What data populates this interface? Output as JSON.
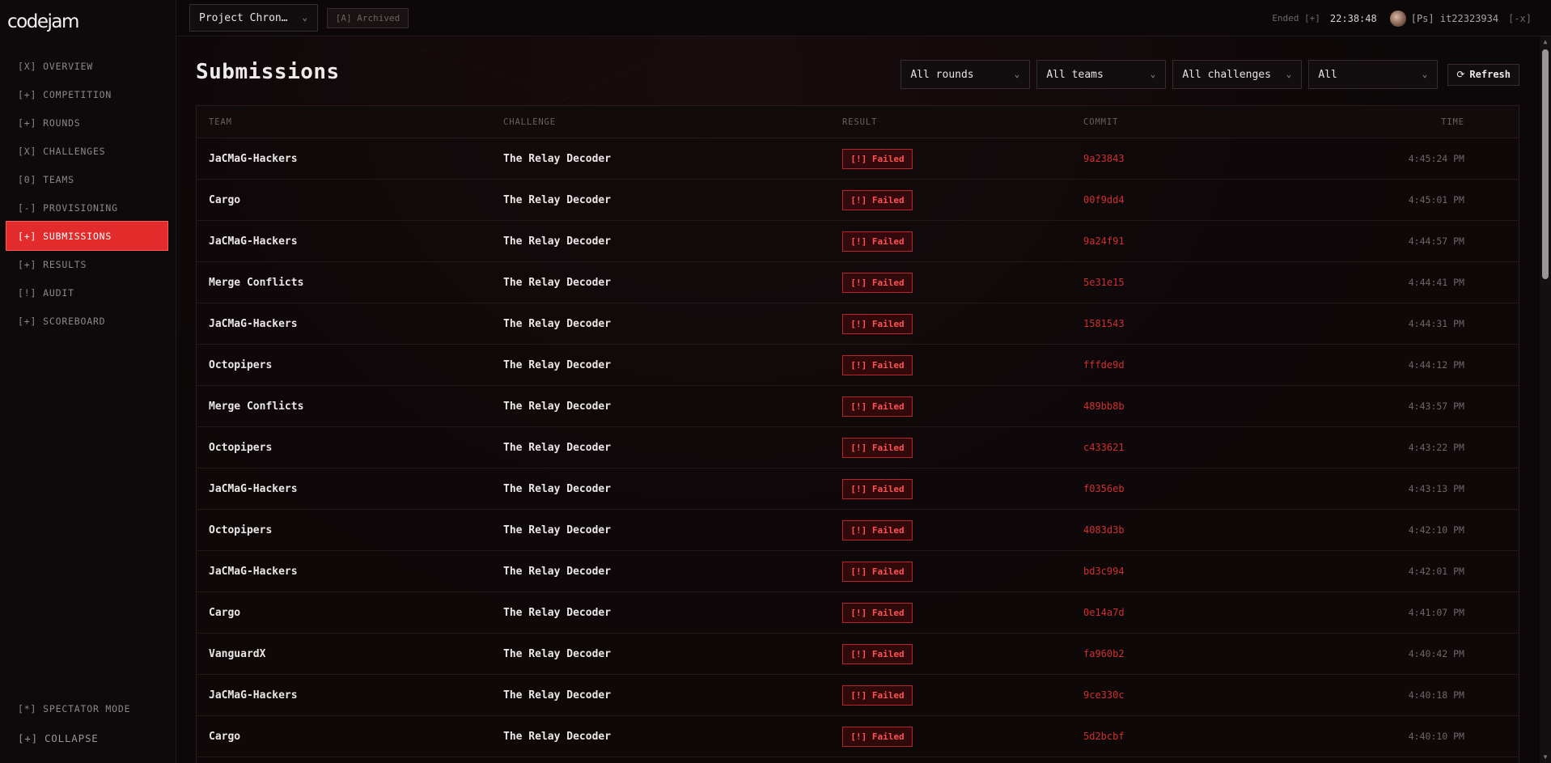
{
  "app": {
    "logo": "codejam"
  },
  "sidebar": {
    "items": [
      {
        "prefix": "[X]",
        "label": "OVERVIEW"
      },
      {
        "prefix": "[+]",
        "label": "COMPETITION"
      },
      {
        "prefix": "[+]",
        "label": "ROUNDS"
      },
      {
        "prefix": "[X]",
        "label": "CHALLENGES"
      },
      {
        "prefix": "[0]",
        "label": "TEAMS"
      },
      {
        "prefix": "[-]",
        "label": "PROVISIONING"
      },
      {
        "prefix": "[+]",
        "label": "SUBMISSIONS",
        "active": true
      },
      {
        "prefix": "[+]",
        "label": "RESULTS"
      },
      {
        "prefix": "[!]",
        "label": "AUDIT"
      },
      {
        "prefix": "[+]",
        "label": "SCOREBOARD"
      }
    ],
    "bottom": [
      {
        "prefix": "[*]",
        "label": "SPECTATOR MODE"
      },
      {
        "prefix": "[+]",
        "label": "COLLAPSE"
      }
    ]
  },
  "topbar": {
    "project": "Project Chron…",
    "archived": "[A] Archived",
    "status": "Ended [+]",
    "clock": "22:38:48",
    "user": "[Ps] it22323934",
    "logout": "[-x]"
  },
  "page": {
    "title": "Submissions",
    "filters": {
      "rounds": "All rounds",
      "teams": "All teams",
      "challenges": "All challenges",
      "status": "All"
    },
    "refresh": "Refresh"
  },
  "table": {
    "headers": {
      "team": "TEAM",
      "challenge": "CHALLENGE",
      "result": "RESULT",
      "commit": "COMMIT",
      "time": "TIME"
    },
    "rows": [
      {
        "team": "JaCMaG-Hackers",
        "challenge": "The Relay Decoder",
        "result": "[!] Failed",
        "commit": "9a23843",
        "time": "4:45:24 PM"
      },
      {
        "team": "Cargo",
        "challenge": "The Relay Decoder",
        "result": "[!] Failed",
        "commit": "00f9dd4",
        "time": "4:45:01 PM"
      },
      {
        "team": "JaCMaG-Hackers",
        "challenge": "The Relay Decoder",
        "result": "[!] Failed",
        "commit": "9a24f91",
        "time": "4:44:57 PM"
      },
      {
        "team": "Merge Conflicts",
        "challenge": "The Relay Decoder",
        "result": "[!] Failed",
        "commit": "5e31e15",
        "time": "4:44:41 PM"
      },
      {
        "team": "JaCMaG-Hackers",
        "challenge": "The Relay Decoder",
        "result": "[!] Failed",
        "commit": "1581543",
        "time": "4:44:31 PM"
      },
      {
        "team": "Octopipers",
        "challenge": "The Relay Decoder",
        "result": "[!] Failed",
        "commit": "fffde9d",
        "time": "4:44:12 PM"
      },
      {
        "team": "Merge Conflicts",
        "challenge": "The Relay Decoder",
        "result": "[!] Failed",
        "commit": "489bb8b",
        "time": "4:43:57 PM"
      },
      {
        "team": "Octopipers",
        "challenge": "The Relay Decoder",
        "result": "[!] Failed",
        "commit": "c433621",
        "time": "4:43:22 PM"
      },
      {
        "team": "JaCMaG-Hackers",
        "challenge": "The Relay Decoder",
        "result": "[!] Failed",
        "commit": "f0356eb",
        "time": "4:43:13 PM"
      },
      {
        "team": "Octopipers",
        "challenge": "The Relay Decoder",
        "result": "[!] Failed",
        "commit": "4083d3b",
        "time": "4:42:10 PM"
      },
      {
        "team": "JaCMaG-Hackers",
        "challenge": "The Relay Decoder",
        "result": "[!] Failed",
        "commit": "bd3c994",
        "time": "4:42:01 PM"
      },
      {
        "team": "Cargo",
        "challenge": "The Relay Decoder",
        "result": "[!] Failed",
        "commit": "0e14a7d",
        "time": "4:41:07 PM"
      },
      {
        "team": "VanguardX",
        "challenge": "The Relay Decoder",
        "result": "[!] Failed",
        "commit": "fa960b2",
        "time": "4:40:42 PM"
      },
      {
        "team": "JaCMaG-Hackers",
        "challenge": "The Relay Decoder",
        "result": "[!] Failed",
        "commit": "9ce330c",
        "time": "4:40:18 PM"
      },
      {
        "team": "Cargo",
        "challenge": "The Relay Decoder",
        "result": "[!] Failed",
        "commit": "5d2bcbf",
        "time": "4:40:10 PM"
      }
    ]
  },
  "icons": {
    "chevron": "chevron-down-icon",
    "refresh": "refresh-icon",
    "avatar": "avatar"
  },
  "colors": {
    "accent": "#e32b2b",
    "failed": "#ff5252",
    "commit": "#d12f2f",
    "background": "#0b0708"
  }
}
